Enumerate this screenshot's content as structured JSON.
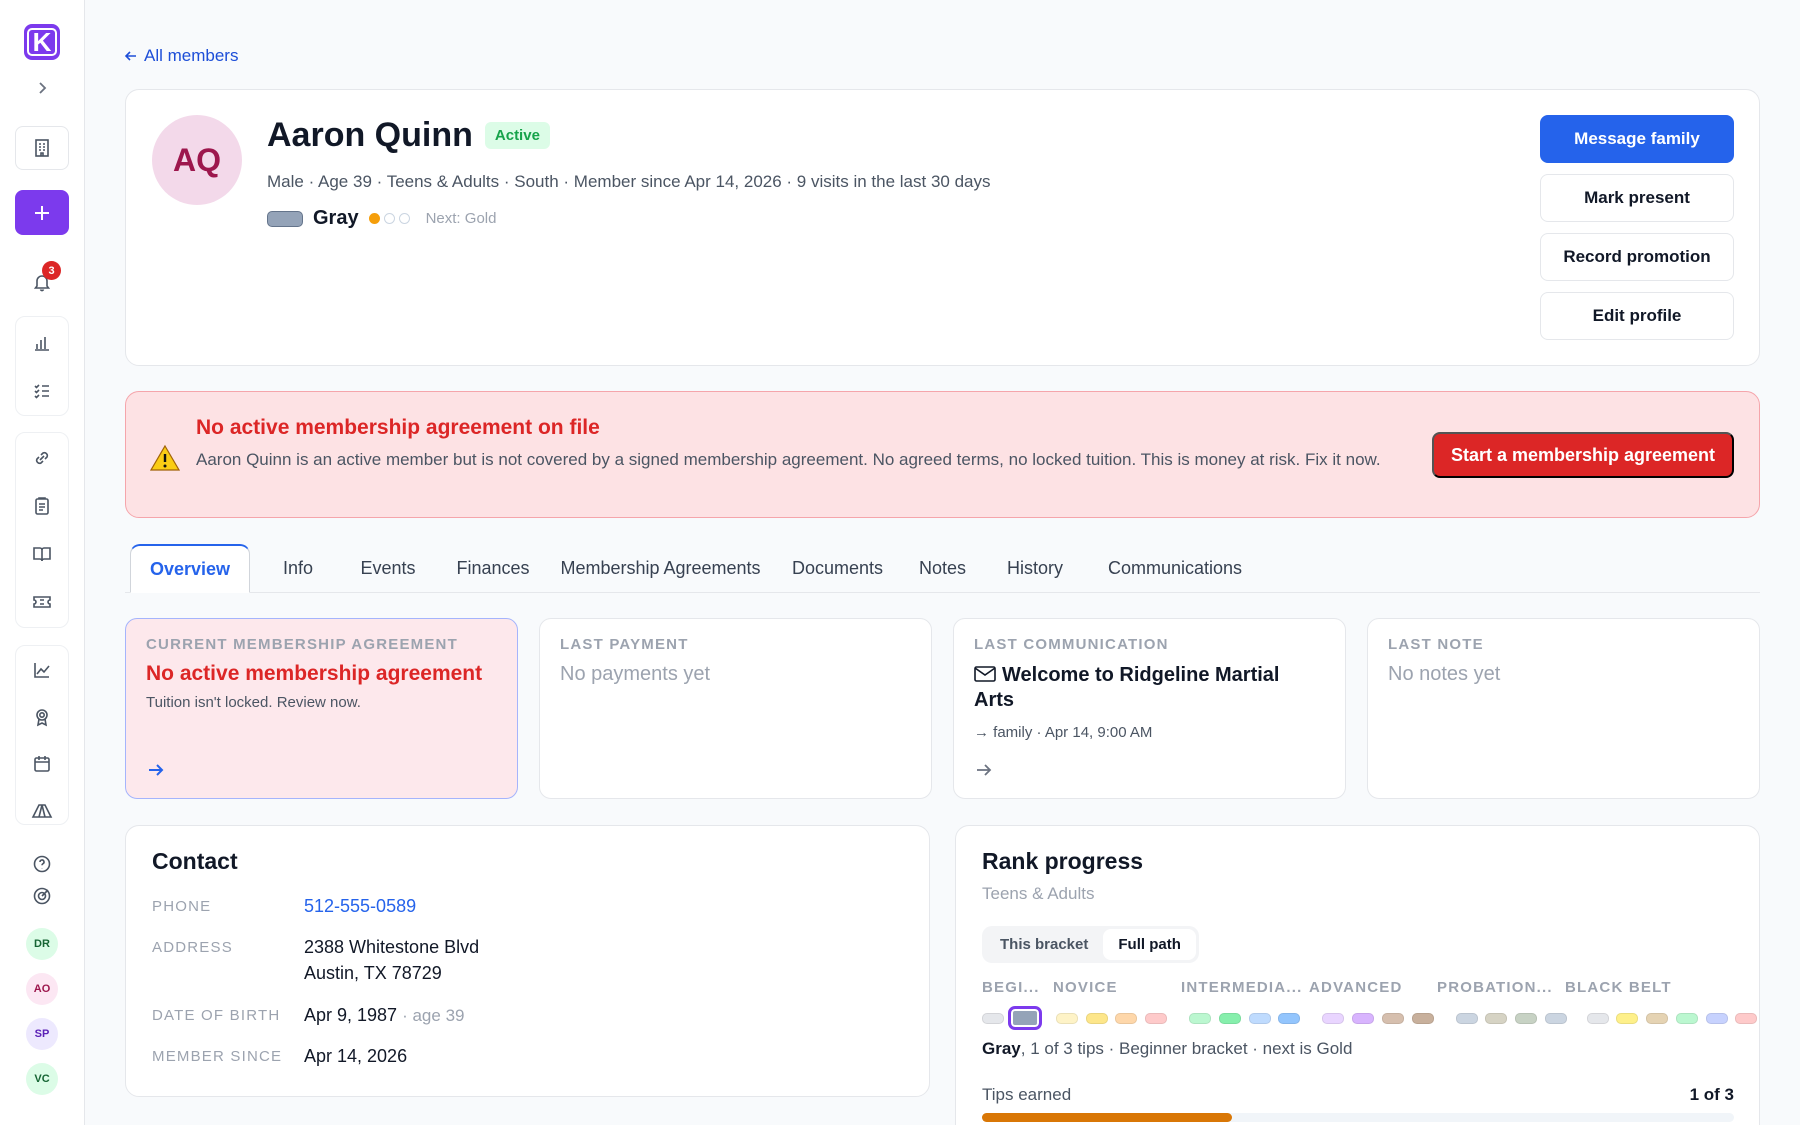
{
  "sidebar": {
    "logo_letter": "K",
    "notification_count": "3",
    "avatars": [
      {
        "initials": "DR",
        "bg": "#dcfce7",
        "fg": "#166534"
      },
      {
        "initials": "AO",
        "bg": "#fce7f3",
        "fg": "#9d174d"
      },
      {
        "initials": "SP",
        "bg": "#ede9fe",
        "fg": "#5b21b6"
      },
      {
        "initials": "VC",
        "bg": "#dcfce7",
        "fg": "#166534"
      }
    ]
  },
  "back_link": "All members",
  "member": {
    "initials": "AQ",
    "name": "Aaron Quinn",
    "status": "Active",
    "meta": "Male · Age 39 · Teens & Adults · South · Member since Apr 14, 2026 · 9 visits in the last 30 days",
    "rank": "Gray",
    "stripes_earned": 1,
    "stripes_total": 3,
    "next_rank": "Next: Gold"
  },
  "actions": {
    "message": "Message family",
    "present": "Mark present",
    "promotion": "Record promotion",
    "edit": "Edit profile"
  },
  "alert": {
    "title": "No active membership agreement on file",
    "text": "Aaron Quinn is an active member but is not covered by a signed membership agreement. No agreed terms, no locked tuition. This is money at risk. Fix it now.",
    "button": "Start a membership agreement"
  },
  "tabs": [
    "Overview",
    "Info",
    "Events",
    "Finances",
    "Membership Agreements",
    "Documents",
    "Notes",
    "History",
    "Communications"
  ],
  "summary": {
    "agreement": {
      "label": "CURRENT MEMBERSHIP AGREEMENT",
      "title": "No active membership agreement",
      "sub": "Tuition isn't locked. Review now."
    },
    "payment": {
      "label": "LAST PAYMENT",
      "empty": "No payments yet"
    },
    "communication": {
      "label": "LAST COMMUNICATION",
      "title": "Welcome to Ridgeline Martial Arts",
      "meta": "→ family · Apr 14, 9:00 AM"
    },
    "note": {
      "label": "LAST NOTE",
      "empty": "No notes yet"
    }
  },
  "contact": {
    "title": "Contact",
    "phone_label": "PHONE",
    "phone": "512-555-0589",
    "address_label": "ADDRESS",
    "address_line1": "2388 Whitestone Blvd",
    "address_line2": "Austin, TX 78729",
    "dob_label": "DATE OF BIRTH",
    "dob": "Apr 9, 1987",
    "dob_age": "· age 39",
    "since_label": "MEMBER SINCE",
    "since": "Apr 14, 2026"
  },
  "rank_progress": {
    "title": "Rank progress",
    "program": "Teens & Adults",
    "toggle": [
      "This bracket",
      "Full path"
    ],
    "toggle_selected": "Full path",
    "stages": [
      "BEGI...",
      "NOVICE",
      "INTERMEDIA...",
      "ADVANCED",
      "PROBATION...",
      "BLACK BELT"
    ],
    "belt_colors": [
      "#e5e7eb",
      "#94a3b8",
      "#fef3c7",
      "#fde68a",
      "#fed7aa",
      "#fecaca",
      "#bbf7d0",
      "#86efac",
      "#bfdbfe",
      "#93c5fd",
      "#e9d5ff",
      "#d8b4fe",
      "#d6bfae",
      "#c8b09c",
      "#cbd5e1",
      "#d6d3c4",
      "#c7d2c4",
      "#cbd5e1",
      "#e5e7eb",
      "#fef08a",
      "#e5d3b3",
      "#bbf7d0",
      "#c7d2fe",
      "#fecaca"
    ],
    "selected_belt_index": 1,
    "status_rank": "Gray",
    "status_text": ", 1 of 3 tips · Beginner bracket · next is Gold",
    "tips_label": "Tips earned",
    "tips_value": "1 of 3",
    "tips_fraction": 0.333
  },
  "colors": {
    "brand": "#7c3aed",
    "primary": "#2563eb",
    "danger": "#dc2626",
    "progress": "#d97706"
  }
}
